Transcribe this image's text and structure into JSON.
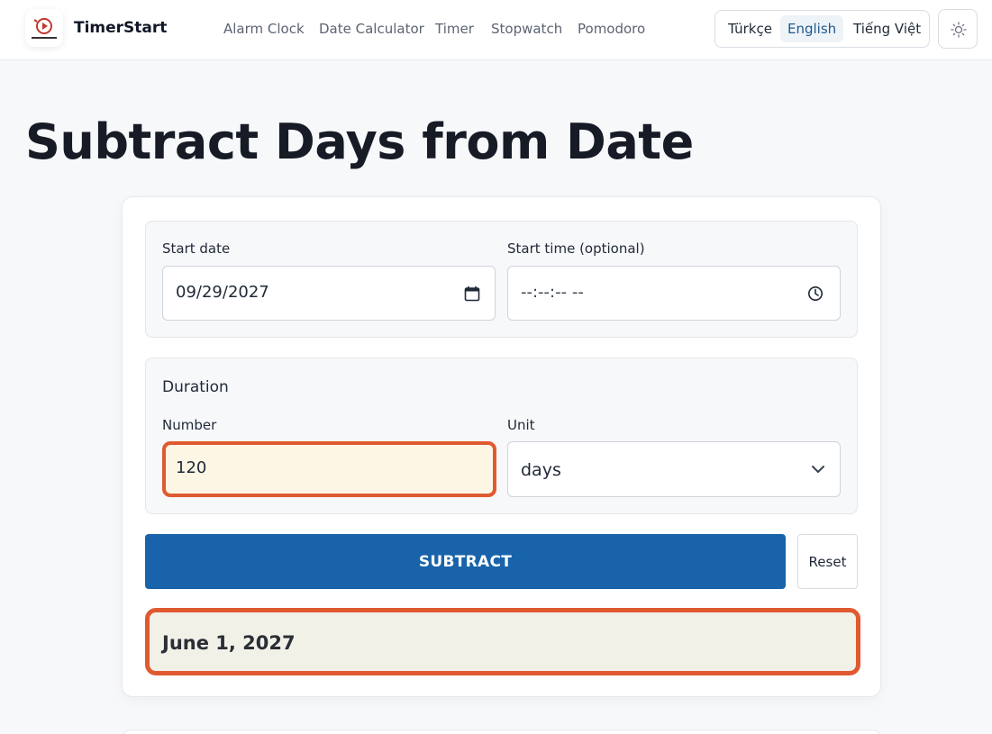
{
  "header": {
    "brand": "TimerStart",
    "nav": [
      "Alarm Clock",
      "Date Calculator",
      "Timer",
      "Stopwatch",
      "Pomodoro"
    ],
    "languages": [
      "Türkçe",
      "English",
      "Tiếng Việt"
    ],
    "active_language": "English"
  },
  "page": {
    "title": "Subtract Days from Date"
  },
  "form": {
    "start_date_label": "Start date",
    "start_date_value": "09/29/2027",
    "start_time_label": "Start time (optional)",
    "start_time_value": "--:--:-- --",
    "duration_title": "Duration",
    "number_label": "Number",
    "number_value": "120",
    "unit_label": "Unit",
    "unit_value": "days",
    "subtract_label": "SUBTRACT",
    "reset_label": "Reset"
  },
  "result": {
    "text": "June 1, 2027"
  },
  "colors": {
    "primary": "#1863a9",
    "highlight": "#e05a30"
  }
}
